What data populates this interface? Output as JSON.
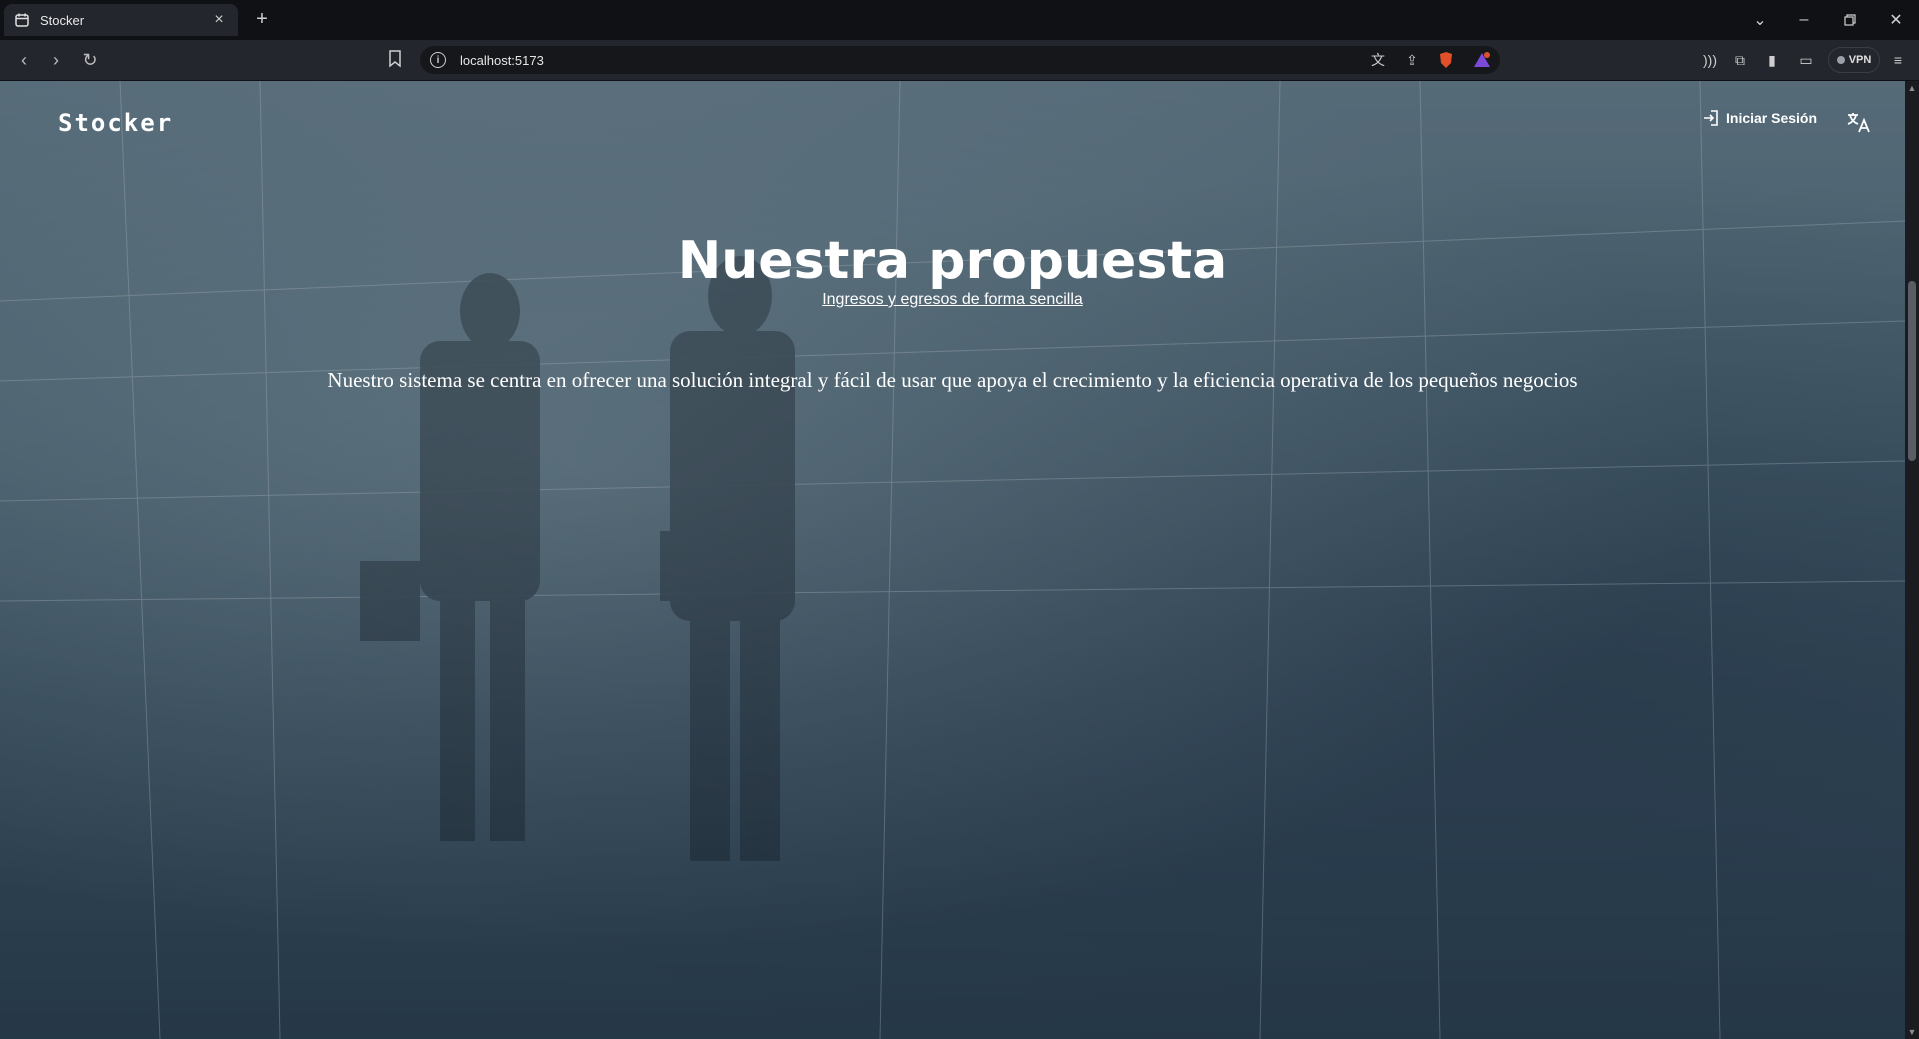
{
  "browser": {
    "tab_title": "Stocker",
    "tab_close": "×",
    "new_tab": "+",
    "url": "localhost:5173",
    "vpn_label": "VPN",
    "icons": [
      "back-icon",
      "forward-icon",
      "reload-icon",
      "bookmark-icon",
      "info-icon",
      "translate-icon",
      "share-icon",
      "brave-shield-icon",
      "brave-rewards-icon",
      "wallet-icon",
      "extensions-icon",
      "sidebar-icon",
      "menu-icon"
    ]
  },
  "nav": {
    "logo": "Stocker",
    "login_label": "Iniciar Sesión"
  },
  "hero": {
    "title": "Nuestra propuesta",
    "subtitle": "Ingresos y egresos de forma sencilla",
    "description": "Nuestro sistema se centra en ofrecer una solución integral y fácil de usar que apoya el crecimiento y la eficiencia operativa de los pequeños negocios"
  }
}
